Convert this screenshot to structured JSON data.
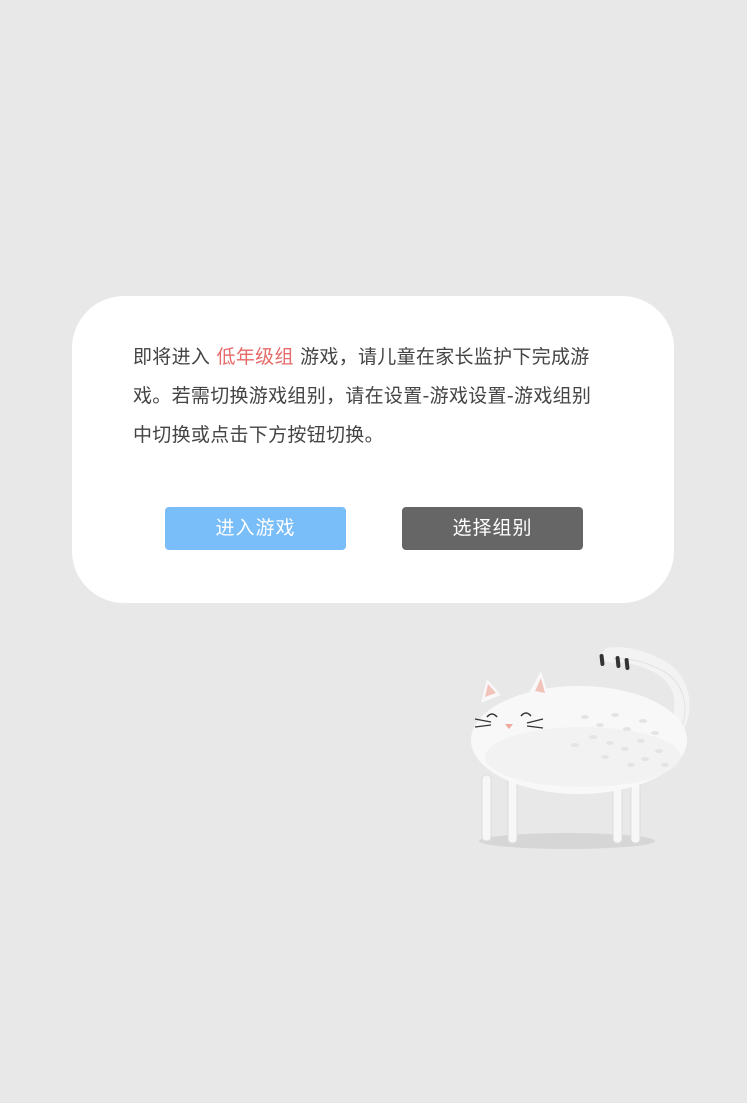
{
  "dialog": {
    "message_part1": "即将进入 ",
    "message_highlight": "低年级组",
    "message_part2": " 游戏，请儿童在家长监护下完成游戏。若需切换游戏组别，请在设置-游戏设置-游戏组别中切换或点击下方按钮切换。",
    "enter_button_label": "进入游戏",
    "select_button_label": "选择组别"
  },
  "colors": {
    "background": "#e8e8e8",
    "highlight": "#e76a6a",
    "enter_button": "#79bdf9",
    "select_button": "#666666"
  },
  "icons": {
    "mascot": "cat-illustration"
  }
}
